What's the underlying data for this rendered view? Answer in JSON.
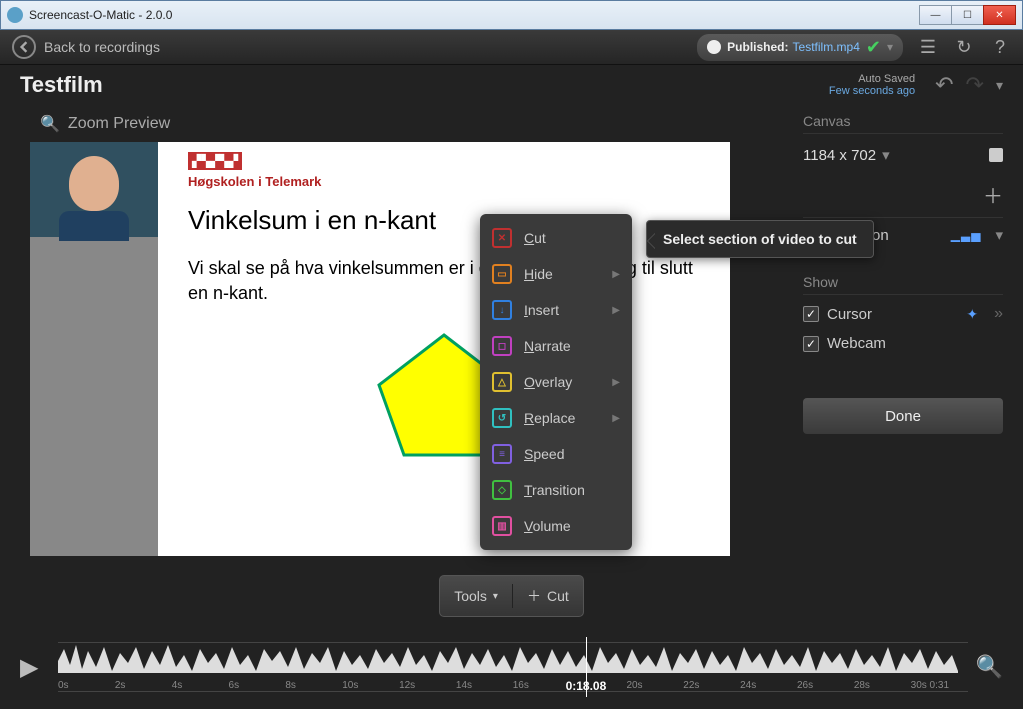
{
  "window": {
    "title": "Screencast-O-Matic - 2.0.0"
  },
  "toolbar": {
    "back_label": "Back to recordings",
    "published_label": "Published:",
    "published_file": "Testfilm.mp4"
  },
  "project": {
    "title": "Testfilm",
    "autosave_label": "Auto Saved",
    "autosave_time": "Few seconds ago"
  },
  "preview": {
    "zoom_label": "Zoom Preview",
    "slide_org": "Høgskolen i Telemark",
    "slide_title": "Vinkelsum i en n-kant",
    "slide_body": "Vi skal se på hva vinkelsummen er i en 5 kant, 6 kant og til slutt en n-kant."
  },
  "panel": {
    "canvas_label": "Canvas",
    "canvas_dim": "1184 x 702",
    "narration_label": "Narration",
    "show_label": "Show",
    "cursor_label": "Cursor",
    "webcam_label": "Webcam",
    "done_label": "Done"
  },
  "context_menu": {
    "items": [
      {
        "key": "cut",
        "label": "Cut",
        "sub": false
      },
      {
        "key": "hide",
        "label": "Hide",
        "sub": true
      },
      {
        "key": "insert",
        "label": "Insert",
        "sub": true
      },
      {
        "key": "narrate",
        "label": "Narrate",
        "sub": false
      },
      {
        "key": "overlay",
        "label": "Overlay",
        "sub": true
      },
      {
        "key": "replace",
        "label": "Replace",
        "sub": true
      },
      {
        "key": "speed",
        "label": "Speed",
        "sub": false
      },
      {
        "key": "transition",
        "label": "Transition",
        "sub": false
      },
      {
        "key": "volume",
        "label": "Volume",
        "sub": false
      }
    ]
  },
  "tooltip": {
    "text": "Select section of video to cut"
  },
  "toolstrip": {
    "tools_label": "Tools",
    "cut_label": "Cut"
  },
  "timeline": {
    "ticks": [
      "0s",
      "2s",
      "4s",
      "6s",
      "8s",
      "10s",
      "12s",
      "14s",
      "16s",
      "",
      "20s",
      "22s",
      "24s",
      "26s",
      "28s",
      "30s 0:31"
    ],
    "current_time": "0:18.08",
    "playhead_pct": 58
  }
}
